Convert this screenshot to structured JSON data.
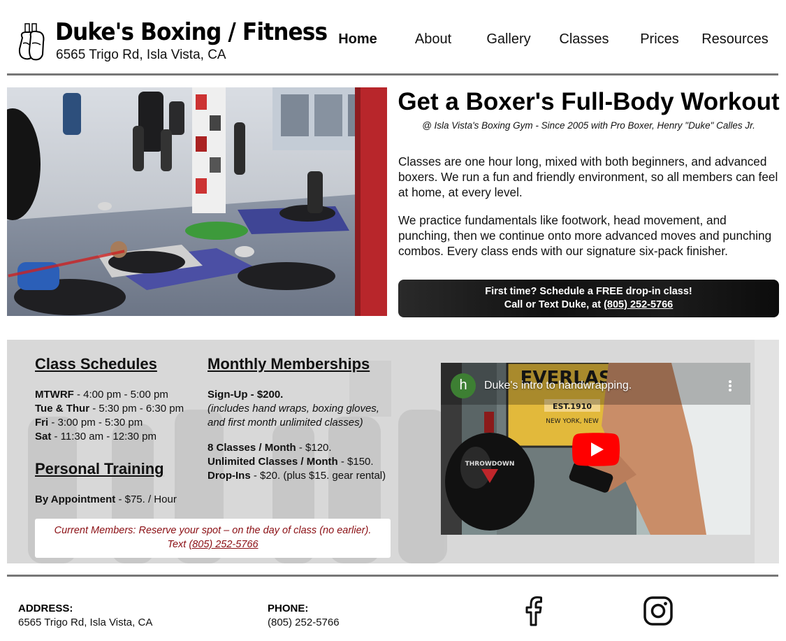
{
  "brand": {
    "name": "Duke's Boxing / Fitness",
    "address": "6565 Trigo Rd, Isla Vista, CA",
    "logo_icon": "boxing-gloves-icon"
  },
  "nav": {
    "items": [
      {
        "label": "Home",
        "active": true
      },
      {
        "label": "About",
        "active": false
      },
      {
        "label": "Gallery",
        "active": false
      },
      {
        "label": "Classes",
        "active": false
      },
      {
        "label": "Prices",
        "active": false
      },
      {
        "label": "Resources",
        "active": false
      }
    ]
  },
  "hero": {
    "title": "Get a Boxer's Full-Body Workout",
    "subtitle": "@ Isla Vista's Boxing Gym - Since 2005 with Pro Boxer, Henry \"Duke\" Calles Jr.",
    "paragraphs": [
      "Classes are one hour long, mixed with both beginners, and advanced boxers. We run a fun and friendly environment, so all members can feel at home, at every level.",
      "We practice fundamentals like footwork, head movement, and punching, then we continue onto more advanced moves and punching combos. Every class ends with our signature six-pack finisher."
    ],
    "cta": {
      "line1": "First time? Schedule a FREE drop-in class!",
      "line2_prefix": "Call or Text Duke, at ",
      "phone": "(805) 252-5766"
    }
  },
  "schedules": {
    "heading": "Class Schedules",
    "rows": [
      {
        "days": "MTWRF",
        "time": " - 4:00 pm - 5:00 pm"
      },
      {
        "days": "Tue & Thur",
        "time": " - 5:30 pm - 6:30 pm"
      },
      {
        "days": "Fri",
        "time": " - 3:00 pm - 5:30 pm"
      },
      {
        "days": "Sat",
        "time": " - 11:30 am - 12:30 pm"
      }
    ]
  },
  "training": {
    "heading": "Personal Training",
    "label": "By Appointment",
    "price": " - $75. / Hour"
  },
  "memberships": {
    "heading": "Monthly Memberships",
    "signup_label": "Sign-Up - $200.",
    "signup_note1": "(includes hand wraps, boxing gloves,",
    "signup_note2": "and first month unlimited classes)",
    "plans": [
      {
        "label": "8 Classes / Month",
        "price": " - $120."
      },
      {
        "label": "Unlimited Classes / Month",
        "price": " - $150."
      },
      {
        "label": "Drop-Ins",
        "price": " - $20. (plus $15. gear rental)"
      }
    ]
  },
  "members_notice": {
    "line1": "Current Members: Reserve your spot – on the day of class (no earlier).",
    "text_prefix": "Text ",
    "phone": "(805) 252-5766"
  },
  "video": {
    "title": "Duke's intro to handwrapping.",
    "channel_initial": "h",
    "poster_text": "EVERLAST",
    "poster_sub": "EST.1910",
    "poster_sub2": "NEW YORK, NEW",
    "bag_brand": "THROWDOWN"
  },
  "footer": {
    "address_label": "ADDRESS:",
    "address": "6565 Trigo Rd, Isla Vista, CA",
    "phone_label": "PHONE:",
    "phone": "(805) 252-5766",
    "social": [
      "facebook-icon",
      "instagram-icon"
    ]
  },
  "colors": {
    "accent_red": "#8b0f14",
    "rule_gray": "#777777",
    "youtube_red": "#ff0000"
  }
}
